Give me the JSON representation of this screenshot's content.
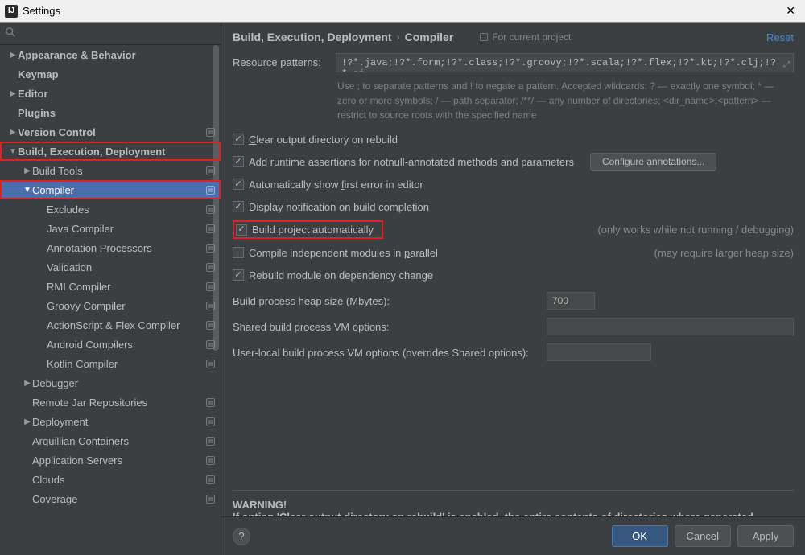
{
  "window": {
    "title": "Settings"
  },
  "search": {
    "placeholder": ""
  },
  "sidebar": {
    "items": [
      {
        "label": "Appearance & Behavior",
        "depth": 0,
        "arrow": "▶",
        "tag": false
      },
      {
        "label": "Keymap",
        "depth": 0,
        "arrow": "",
        "tag": false
      },
      {
        "label": "Editor",
        "depth": 0,
        "arrow": "▶",
        "tag": false
      },
      {
        "label": "Plugins",
        "depth": 0,
        "arrow": "",
        "tag": false
      },
      {
        "label": "Version Control",
        "depth": 0,
        "arrow": "▶",
        "tag": true
      },
      {
        "label": "Build, Execution, Deployment",
        "depth": 0,
        "arrow": "▼",
        "tag": false,
        "hl": true
      },
      {
        "label": "Build Tools",
        "depth": 1,
        "arrow": "▶",
        "tag": true
      },
      {
        "label": "Compiler",
        "depth": 1,
        "arrow": "▼",
        "tag": true,
        "selected": true,
        "hl": true
      },
      {
        "label": "Excludes",
        "depth": 2,
        "arrow": "",
        "tag": true
      },
      {
        "label": "Java Compiler",
        "depth": 2,
        "arrow": "",
        "tag": true
      },
      {
        "label": "Annotation Processors",
        "depth": 2,
        "arrow": "",
        "tag": true
      },
      {
        "label": "Validation",
        "depth": 2,
        "arrow": "",
        "tag": true
      },
      {
        "label": "RMI Compiler",
        "depth": 2,
        "arrow": "",
        "tag": true
      },
      {
        "label": "Groovy Compiler",
        "depth": 2,
        "arrow": "",
        "tag": true
      },
      {
        "label": "ActionScript & Flex Compiler",
        "depth": 2,
        "arrow": "",
        "tag": true
      },
      {
        "label": "Android Compilers",
        "depth": 2,
        "arrow": "",
        "tag": true
      },
      {
        "label": "Kotlin Compiler",
        "depth": 2,
        "arrow": "",
        "tag": true
      },
      {
        "label": "Debugger",
        "depth": 1,
        "arrow": "▶",
        "tag": false
      },
      {
        "label": "Remote Jar Repositories",
        "depth": 1,
        "arrow": "",
        "tag": true
      },
      {
        "label": "Deployment",
        "depth": 1,
        "arrow": "▶",
        "tag": true
      },
      {
        "label": "Arquillian Containers",
        "depth": 1,
        "arrow": "",
        "tag": true
      },
      {
        "label": "Application Servers",
        "depth": 1,
        "arrow": "",
        "tag": true
      },
      {
        "label": "Clouds",
        "depth": 1,
        "arrow": "",
        "tag": true
      },
      {
        "label": "Coverage",
        "depth": 1,
        "arrow": "",
        "tag": true
      }
    ]
  },
  "breadcrumb": {
    "a": "Build, Execution, Deployment",
    "b": "Compiler"
  },
  "header": {
    "for_project": "For current project",
    "reset": "Reset"
  },
  "main": {
    "resource_label": "Resource patterns:",
    "resource_value": "!?*.java;!?*.form;!?*.class;!?*.groovy;!?*.scala;!?*.flex;!?*.kt;!?*.clj;!?*.aj",
    "resource_help": "Use ; to separate patterns and ! to negate a pattern. Accepted wildcards: ? — exactly one symbol; * — zero or more symbols; / — path separator; /**/ — any number of directories; <dir_name>:<pattern> — restrict to source roots with the specified name",
    "chk_clear": "Clear output directory on rebuild",
    "chk_runtime": "Add runtime assertions for notnull-annotated methods and parameters",
    "btn_configure": "Configure annotations...",
    "chk_first_error": "Automatically show first error in editor",
    "chk_notify": "Display notification on build completion",
    "chk_auto": "Build project automatically",
    "chk_auto_note": "(only works while not running / debugging)",
    "chk_parallel": "Compile independent modules in parallel",
    "chk_parallel_note": "(may require larger heap size)",
    "chk_rebuild": "Rebuild module on dependency change",
    "heap_label": "Build process heap size (Mbytes):",
    "heap_value": "700",
    "shared_label": "Shared build process VM options:",
    "user_label": "User-local build process VM options (overrides Shared options):",
    "warn_title": "WARNING!",
    "warn_body": "If option 'Clear output directory on rebuild' is enabled, the entire contents of directories where generated sources are stored WILL BE CLEARED on rebuild."
  },
  "footer": {
    "ok": "OK",
    "cancel": "Cancel",
    "apply": "Apply"
  }
}
